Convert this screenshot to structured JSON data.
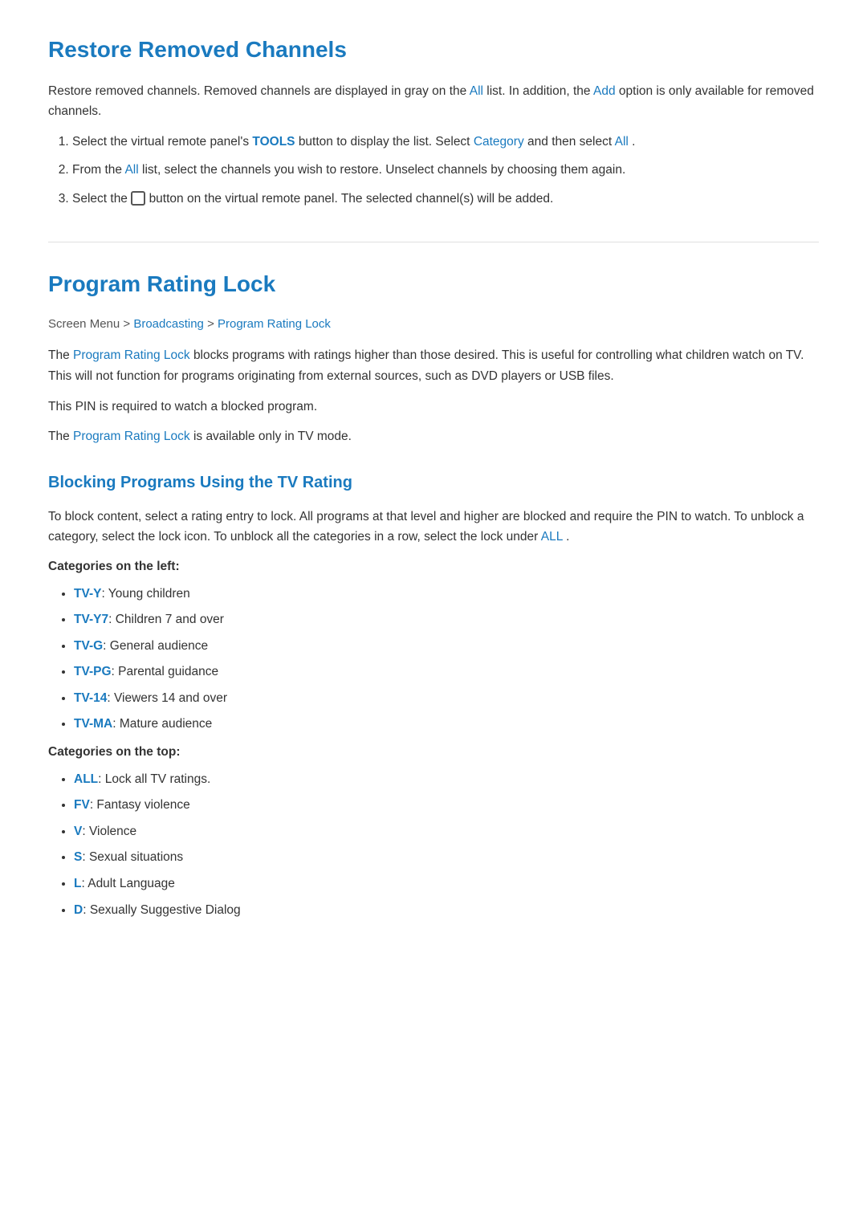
{
  "section1": {
    "title": "Restore Removed Channels",
    "intro": "Restore removed channels. Removed channels are displayed in gray on the",
    "intro_all": "All",
    "intro_mid": "list. In addition, the",
    "intro_add": "Add",
    "intro_end": "option is only available for removed channels.",
    "steps": [
      {
        "text_start": "Select the virtual remote panel's",
        "tools": "TOOLS",
        "text_mid": "button to display the list. Select",
        "category": "Category",
        "text_mid2": "and then select",
        "all": "All",
        "text_end": "."
      },
      {
        "text_start": "From the",
        "all": "All",
        "text_mid": "list, select the channels you wish to restore. Unselect channels by choosing them again."
      },
      {
        "text_start": "Select the",
        "icon": "(",
        "text_mid": "button on the virtual remote panel. The selected channel(s) will be added."
      }
    ]
  },
  "section2": {
    "title": "Program Rating Lock",
    "breadcrumb": {
      "prefix": "Screen Menu",
      "sep1": " > ",
      "broadcasting": "Broadcasting",
      "sep2": " > ",
      "lock": "Program Rating Lock"
    },
    "para1_start": "The",
    "para1_link": "Program Rating Lock",
    "para1_end": "blocks programs with ratings higher than those desired. This is useful for controlling what children watch on TV. This will not function for programs originating from external sources, such as DVD players or USB files.",
    "para2": "This PIN is required to watch a blocked program.",
    "para3_start": "The",
    "para3_link": "Program Rating Lock",
    "para3_end": "is available only in TV mode.",
    "subsection": {
      "title": "Blocking Programs Using the TV Rating",
      "para1": "To block content, select a rating entry to lock. All programs at that level and higher are blocked and require the PIN to watch. To unblock a category, select the lock icon. To unblock all the categories in a row, select the lock under",
      "all": "ALL",
      "para1_end": ".",
      "left_label": "Categories on the left:",
      "left_items": [
        {
          "bold": "TV-Y",
          "text": ": Young children"
        },
        {
          "bold": "TV-Y7",
          "text": ": Children 7 and over"
        },
        {
          "bold": "TV-G",
          "text": ": General audience"
        },
        {
          "bold": "TV-PG",
          "text": ": Parental guidance"
        },
        {
          "bold": "TV-14",
          "text": ": Viewers 14 and over"
        },
        {
          "bold": "TV-MA",
          "text": ": Mature audience"
        }
      ],
      "top_label": "Categories on the top:",
      "top_items": [
        {
          "bold": "ALL",
          "text": ": Lock all TV ratings."
        },
        {
          "bold": "FV",
          "text": ": Fantasy violence"
        },
        {
          "bold": "V",
          "text": ": Violence"
        },
        {
          "bold": "S",
          "text": ": Sexual situations"
        },
        {
          "bold": "L",
          "text": ": Adult Language"
        },
        {
          "bold": "D",
          "text": ": Sexually Suggestive Dialog"
        }
      ]
    }
  }
}
